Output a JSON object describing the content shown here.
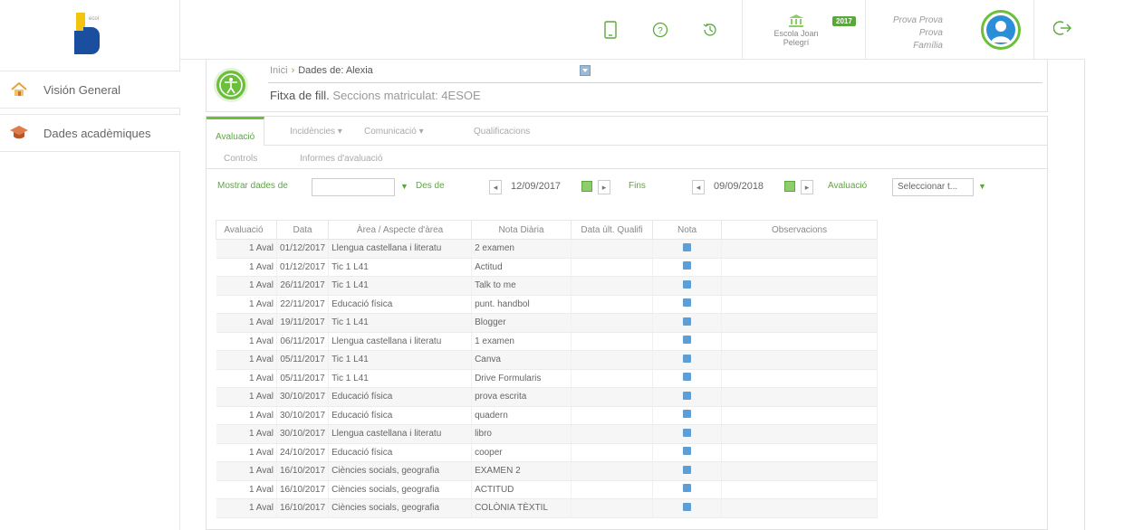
{
  "sidebar": {
    "logo_text": "ecol",
    "items": [
      {
        "label": "Visión General",
        "icon": "home-icon"
      },
      {
        "label": "Dades acadèmiques",
        "icon": "graduation-cap-icon"
      }
    ]
  },
  "topbar": {
    "icons": [
      "mobile-icon",
      "help-icon",
      "history-icon"
    ],
    "school_name": "Escola Joan Pelegrí",
    "year": "2017",
    "user_name": "Prova Prova Prova",
    "user_role": "Família"
  },
  "header": {
    "breadcrumb_home": "Inici",
    "breadcrumb_current": "Dades de: Alexia",
    "title_bold": "Fitxa de fill.",
    "title_rest": " Seccions matriculat: 4ESOE"
  },
  "tabs": [
    {
      "label": "Avaluació",
      "active": true
    },
    {
      "label": "Incidències ▾",
      "active": false
    },
    {
      "label": "Comunicació ▾",
      "active": false
    },
    {
      "label": "Qualificacions",
      "active": false
    }
  ],
  "subtabs": [
    "Controls",
    "Informes d'avaluació"
  ],
  "filters": {
    "show_label": "Mostrar dades de",
    "show_value": "",
    "from_label": "Des de",
    "from_date": "12/09/2017",
    "to_label": "Fins",
    "to_date": "09/09/2018",
    "eval_label": "Avaluació",
    "eval_value": "Seleccionar t..."
  },
  "table": {
    "columns": [
      "Avaluació",
      "Data",
      "Àrea / Aspecte d'àrea",
      "Nota Diària",
      "Data últ. Qualifi",
      "Nota",
      "Observacions"
    ],
    "rows": [
      {
        "aval": "1 Aval",
        "data": "01/12/2017",
        "area": "Llengua castellana i literatu",
        "nota": "2 examen",
        "color": "blue"
      },
      {
        "aval": "1 Aval",
        "data": "01/12/2017",
        "area": "Tic 1 L41",
        "nota": "Actitud",
        "color": "dark"
      },
      {
        "aval": "1 Aval",
        "data": "26/11/2017",
        "area": "Tic 1 L41",
        "nota": "Talk to me",
        "color": "dark"
      },
      {
        "aval": "1 Aval",
        "data": "22/11/2017",
        "area": "Educació física",
        "nota": "punt. handbol",
        "color": "dark"
      },
      {
        "aval": "1 Aval",
        "data": "19/11/2017",
        "area": "Tic 1 L41",
        "nota": "Blogger",
        "color": "green"
      },
      {
        "aval": "1 Aval",
        "data": "06/11/2017",
        "area": "Llengua castellana i literatu",
        "nota": "1 examen",
        "color": "red"
      },
      {
        "aval": "1 Aval",
        "data": "05/11/2017",
        "area": "Tic 1 L41",
        "nota": "Canva",
        "color": "red"
      },
      {
        "aval": "1 Aval",
        "data": "05/11/2017",
        "area": "Tic 1 L41",
        "nota": "Drive Formularis",
        "color": "blue"
      },
      {
        "aval": "1 Aval",
        "data": "30/10/2017",
        "area": "Educació física",
        "nota": "prova escrita",
        "color": "dark"
      },
      {
        "aval": "1 Aval",
        "data": "30/10/2017",
        "area": "Educació física",
        "nota": "quadern",
        "color": "dark"
      },
      {
        "aval": "1 Aval",
        "data": "30/10/2017",
        "area": "Llengua castellana i literatu",
        "nota": "libro",
        "color": "dark"
      },
      {
        "aval": "1 Aval",
        "data": "24/10/2017",
        "area": "Educació física",
        "nota": "cooper",
        "color": "dark"
      },
      {
        "aval": "1 Aval",
        "data": "16/10/2017",
        "area": "Ciències socials, geografia",
        "nota": "EXAMEN 2",
        "color": "dark"
      },
      {
        "aval": "1 Aval",
        "data": "16/10/2017",
        "area": "Ciències socials, geografia",
        "nota": "ACTITUD",
        "color": "dark"
      },
      {
        "aval": "1 Aval",
        "data": "16/10/2017",
        "area": "Ciències socials, geografia",
        "nota": "COLÒNIA TÈXTIL",
        "color": "dark"
      }
    ]
  }
}
